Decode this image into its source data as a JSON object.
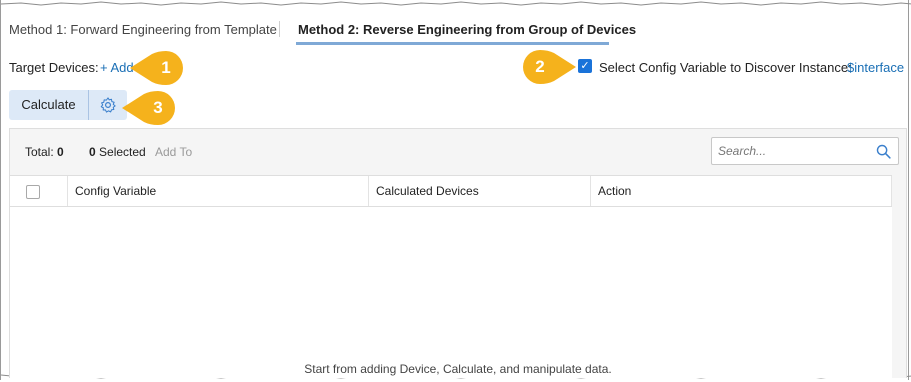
{
  "tabs": [
    {
      "label": "Method 1: Forward Engineering from Template"
    },
    {
      "label": "Method 2: Reverse Engineering from Group of Devices"
    }
  ],
  "target_devices": {
    "label": "Target Devices:",
    "add_link": "+ Add"
  },
  "config_variable": {
    "checked": true,
    "check_glyph": "✓",
    "label": "Select Config Variable to Discover Instance:",
    "value": "$interface"
  },
  "calculate": {
    "button_label": "Calculate",
    "settings_icon": "gear-icon"
  },
  "callouts": [
    "1",
    "2",
    "3"
  ],
  "toolbar": {
    "total_label": "Total:",
    "total_value": "0",
    "selected_value": "0",
    "selected_label": "Selected",
    "add_to_label": "Add To"
  },
  "search": {
    "placeholder": "Search...",
    "value": ""
  },
  "table": {
    "columns": [
      "Config Variable",
      "Calculated Devices",
      "Action"
    ],
    "empty_message": "Start from adding Device, Calculate, and manipulate data."
  },
  "colors": {
    "accent": "#1a6fb5",
    "callout": "#f5b21c",
    "tab_underline": "#7fa9d6",
    "button_bg": "#dde9f7"
  }
}
